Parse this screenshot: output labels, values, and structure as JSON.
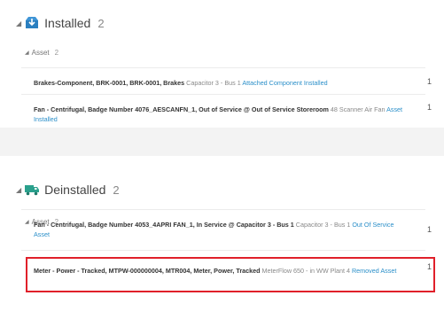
{
  "installed": {
    "title": "Installed",
    "count": "2",
    "asset_group": {
      "label": "Asset",
      "count": "2"
    },
    "items": [
      {
        "title": "Brakes-Component, BRK-0001, BRK-0001, Brakes",
        "desc": "Capacitor 3 - Bus 1",
        "status": "Attached Component Installed",
        "qty": "1"
      },
      {
        "title": "Fan - Centrifugal, Badge Number 4076_AESCANFN_1, Out of Service @ Out of Service Storeroom",
        "desc": "48 Scanner Air Fan",
        "status": "Asset Installed",
        "qty": "1"
      }
    ]
  },
  "deinstalled": {
    "title": "Deinstalled",
    "count": "2",
    "asset_group": {
      "label": "Asset",
      "count": "2"
    },
    "items": [
      {
        "title": "Fan - Centrifugal, Badge Number 4053_4APRI FAN_1, In Service @ Capacitor 3 - Bus 1",
        "desc": "Capacitor 3 - Bus 1",
        "status": "Out Of Service Asset",
        "qty": "1"
      },
      {
        "title": "Meter - Power - Tracked, MTPW-000000004, MTR004, Meter, Power, Tracked",
        "desc": "MeterFlow 650 - in WW Plant 4",
        "status": "Removed Asset",
        "qty": "1"
      }
    ]
  },
  "colors": {
    "accent": "#2b8fc9",
    "installed_icon": "#2a7fc0",
    "deinstalled_icon": "#2aa08c",
    "highlight": "#e0202a"
  },
  "icons": {
    "installed": "install-box-icon",
    "deinstalled": "deinstall-truck-icon",
    "expand": "triangle-down-icon"
  }
}
